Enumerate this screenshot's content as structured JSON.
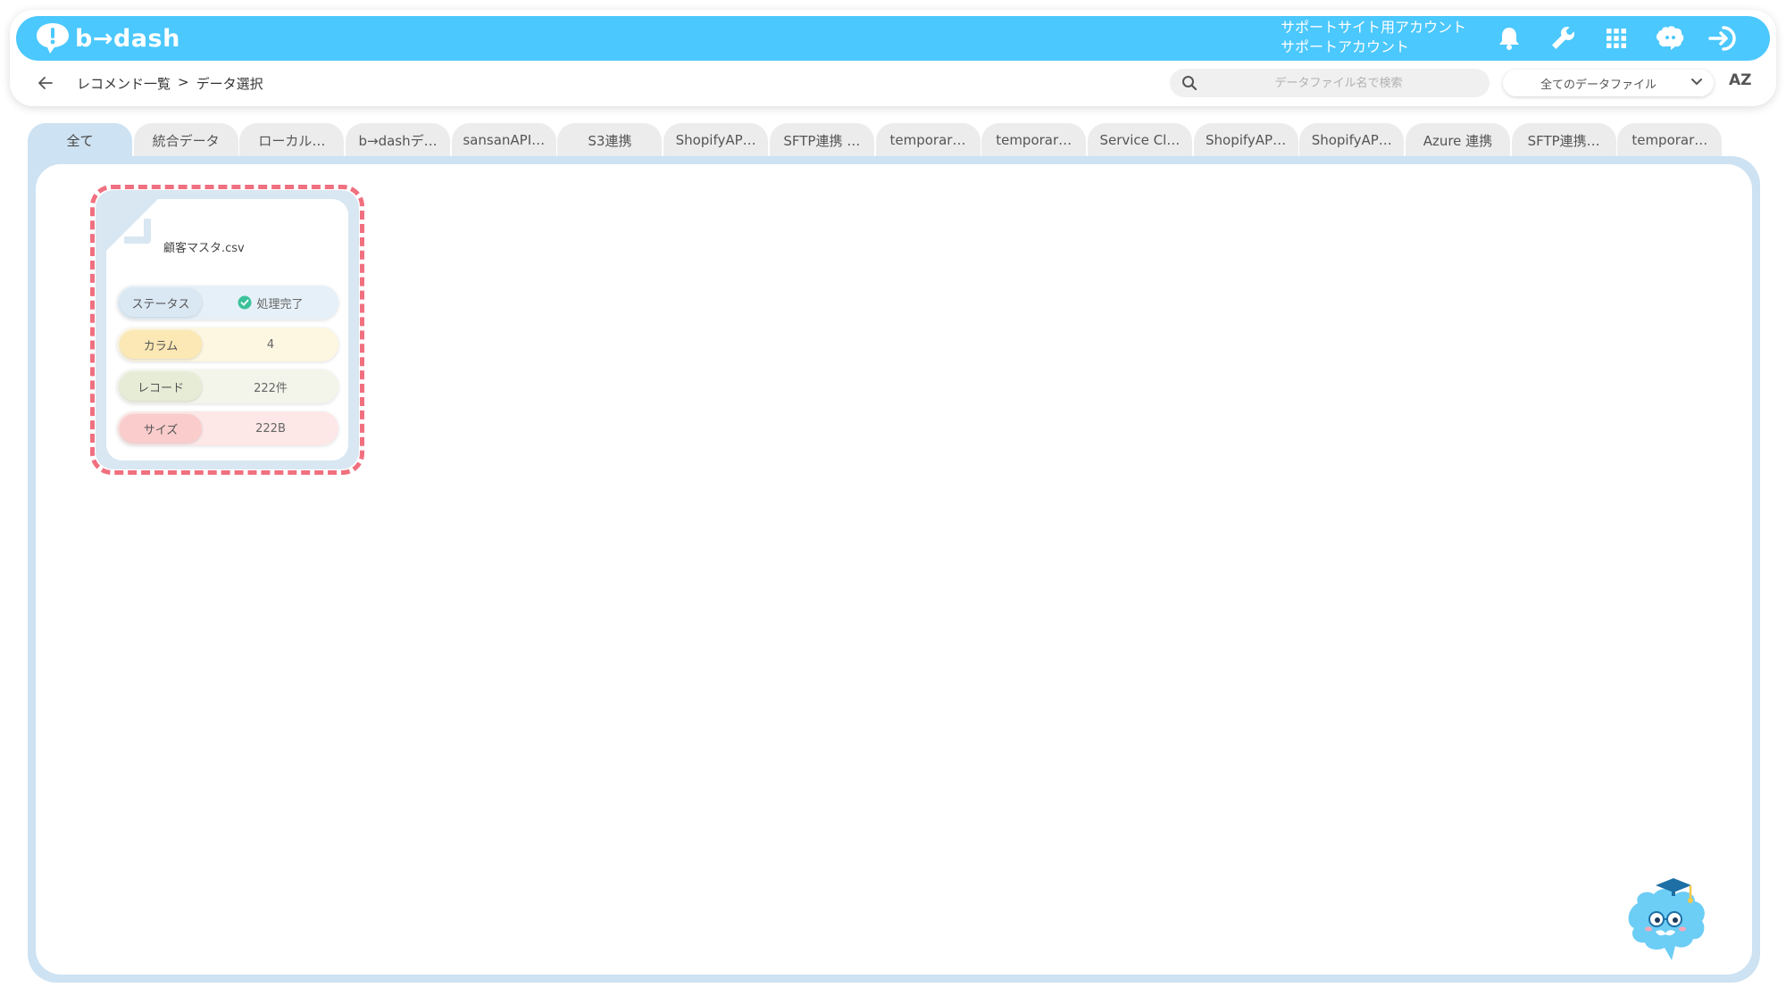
{
  "header": {
    "logo_text": "b→dash",
    "account_line1": "サポートサイト用アカウント",
    "account_line2": "サポートアカウント",
    "icons": [
      "bell-icon",
      "wrench-icon",
      "grid-icon",
      "brain-icon",
      "sign-in-icon"
    ]
  },
  "breadcrumb": {
    "item1": "レコメンド一覧",
    "separator": ">",
    "item2": "データ選択"
  },
  "search": {
    "placeholder": "データファイル名で検索"
  },
  "filter": {
    "selected": "全てのデータファイル"
  },
  "sort_label": "AZ",
  "tabs": [
    "全て",
    "統合データ",
    "ローカル…",
    "b→dashデ…",
    "sansanAPI…",
    "S3連携",
    "ShopifyAP…",
    "SFTP連携 …",
    "temporar…",
    "temporar…",
    "Service Cl…",
    "ShopifyAP…",
    "ShopifyAP…",
    "Azure 連携",
    "SFTP連携…",
    "temporar…"
  ],
  "active_tab": "全て",
  "file_card": {
    "name": "顧客マスタ.csv",
    "status_label": "ステータス",
    "status_value": "処理完了",
    "column_label": "カラム",
    "column_value": "4",
    "record_label": "レコード",
    "record_value": "222件",
    "size_label": "サイズ",
    "size_value": "222B"
  },
  "colors": {
    "brand_blue": "#4bc8fd",
    "highlight_red": "#f07080",
    "status_green": "#3cc29a"
  }
}
